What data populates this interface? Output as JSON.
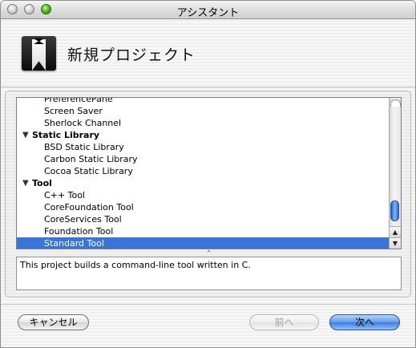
{
  "window": {
    "title": "アシスタント"
  },
  "header": {
    "title": "新規プロジェクト",
    "icon": "tuxedo-app-icon"
  },
  "template_list": {
    "items": [
      {
        "type": "child",
        "label": "PreferencePane"
      },
      {
        "type": "child",
        "label": "Screen Saver"
      },
      {
        "type": "child",
        "label": "Sherlock Channel"
      },
      {
        "type": "group",
        "label": "Static Library",
        "expanded": true
      },
      {
        "type": "child",
        "label": "BSD Static Library"
      },
      {
        "type": "child",
        "label": "Carbon Static Library"
      },
      {
        "type": "child",
        "label": "Cocoa Static Library"
      },
      {
        "type": "group",
        "label": "Tool",
        "expanded": true
      },
      {
        "type": "child",
        "label": "C++ Tool"
      },
      {
        "type": "child",
        "label": "CoreFoundation Tool"
      },
      {
        "type": "child",
        "label": "CoreServices Tool"
      },
      {
        "type": "child",
        "label": "Foundation Tool"
      },
      {
        "type": "child",
        "label": "Standard Tool",
        "selected": true
      }
    ],
    "group_triangle_glyph": "▼",
    "scroll_arrow_up": "▲",
    "scroll_arrow_down": "▼",
    "resize_glyph": "⌃"
  },
  "description": {
    "text": "This project builds a command-line tool written in C."
  },
  "buttons": {
    "cancel": "キャンセル",
    "back": "前へ",
    "next": "次へ"
  },
  "colors": {
    "selection": "#3875d7",
    "default_button": "#3a7ee0",
    "zoom_button": "#48b21b"
  }
}
